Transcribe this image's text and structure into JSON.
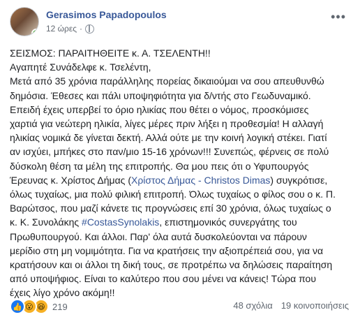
{
  "author": {
    "name": "Gerasimos Papadopoulos",
    "time": "12 ώρες",
    "avatar_icon": "profile-photo"
  },
  "post": {
    "lines": [
      "ΣΕΙΣΜΟΣ: ΠΑΡΑΙΤΗΘΕΙΤΕ κ. Α. ΤΣΕΛΕΝΤΗ!!",
      "Αγαπητέ Συνάδελφε κ. Τσελέντη,",
      "Μετά από 35 χρόνια παράλληλης πορείας δικαιούμαι να σου απευθυνθώ",
      "δημόσια. Έθεσες και πάλι υποψηφιότητα για δ/ντής στο Γεωδυναμικό.",
      "Επειδή έχεις υπερβεί το όριο ηλικίας που θέτει ο νόμος, προσκόμισες",
      "χαρτιά για νεώτερη ηλικία, λίγες μέρες πριν λήξει η προθεσμία! Η αλλαγή",
      "ηλικίας νομικά δε γίνεται δεκτή. Αλλά ούτε με την κοινή λογική στέκει. Γιατί",
      "αν ισχύει, μπήκες στο παν/μιο 15-16 χρόνων!!! Συνεπώς, φέρνεις σε πολύ",
      "δύσκολη θέση τα μέλη της επιτροπής. Θα μου πεις ότι ο Υφυπουργός"
    ],
    "line10_pre": "Έρευνας κ. Χρίστος Δήμας (",
    "line10_link": "Χρίστος Δήμας - Christos Dimas",
    "line10_post": ") συγκρότισε,",
    "lines_mid": [
      "όλως τυχαίως, μια πολύ φιλική επιτροπή. Όλως τυχαίως ο φίλος σου ο κ. Π.",
      "Βαρώτσος, που μαζί κάνετε τις προγνώσεις επί 30 χρόνια, όλως τυχαίως ο"
    ],
    "line13_pre": "κ. Κ. Συνολάκης ",
    "line13_link": "#CostasSynolakis",
    "line13_post": ", επιστημονικός συνεργάτης του",
    "lines_end": [
      "Πρωθυπουργού. Και άλλοι. Παρ' όλα αυτά δυσκολεύονται να πάρουν",
      "μερίδιο στη μη νομιμότητα. Για να κρατήσεις την αξιοπρέπειά σου, για να",
      "κρατήσουν και οι άλλοι τη δική τους, σε προτρέπω να δηλώσεις παραίτηση",
      "από υποψήφιος. Είναι το καλύτερο που σου μένει να κάνεις! Τώρα που",
      "έχεις λίγο χρόνο ακόμη!!"
    ]
  },
  "footer": {
    "reaction_count": "219",
    "comments": "48 σχόλια",
    "shares": "19 κοινοποιήσεις",
    "reactions": [
      "like-icon",
      "wow-icon",
      "haha-icon"
    ]
  },
  "colors": {
    "link": "#385898",
    "text": "#1c1e21",
    "meta": "#616770"
  }
}
